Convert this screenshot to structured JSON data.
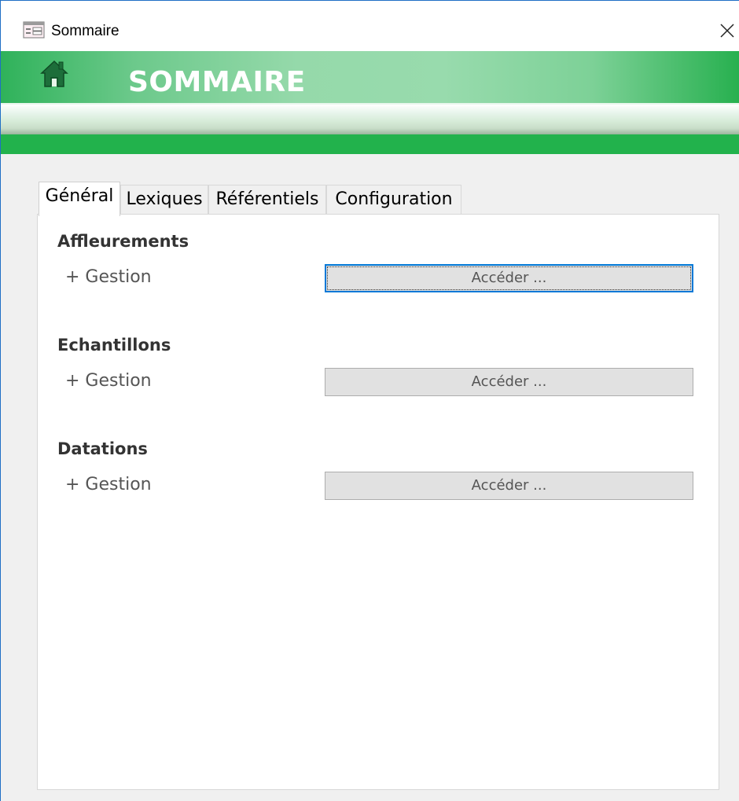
{
  "window": {
    "title": "Sommaire",
    "close_glyph": "✕"
  },
  "banner": {
    "title": "SOMMAIRE",
    "icon": "home-icon"
  },
  "tabs": [
    {
      "label": "Général",
      "active": true
    },
    {
      "label": "Lexiques",
      "active": false
    },
    {
      "label": "Référentiels",
      "active": false
    },
    {
      "label": "Configuration",
      "active": false
    }
  ],
  "sections": [
    {
      "heading": "Affleurements",
      "row_label": "+ Gestion",
      "button_label": "Accéder ...",
      "focused": true
    },
    {
      "heading": "Echantillons",
      "row_label": "+ Gestion",
      "button_label": "Accéder ...",
      "focused": false
    },
    {
      "heading": "Datations",
      "row_label": "+ Gestion",
      "button_label": "Accéder ...",
      "focused": false
    }
  ],
  "colors": {
    "banner_green": "#22b24c",
    "focus_blue": "#0078d7"
  }
}
